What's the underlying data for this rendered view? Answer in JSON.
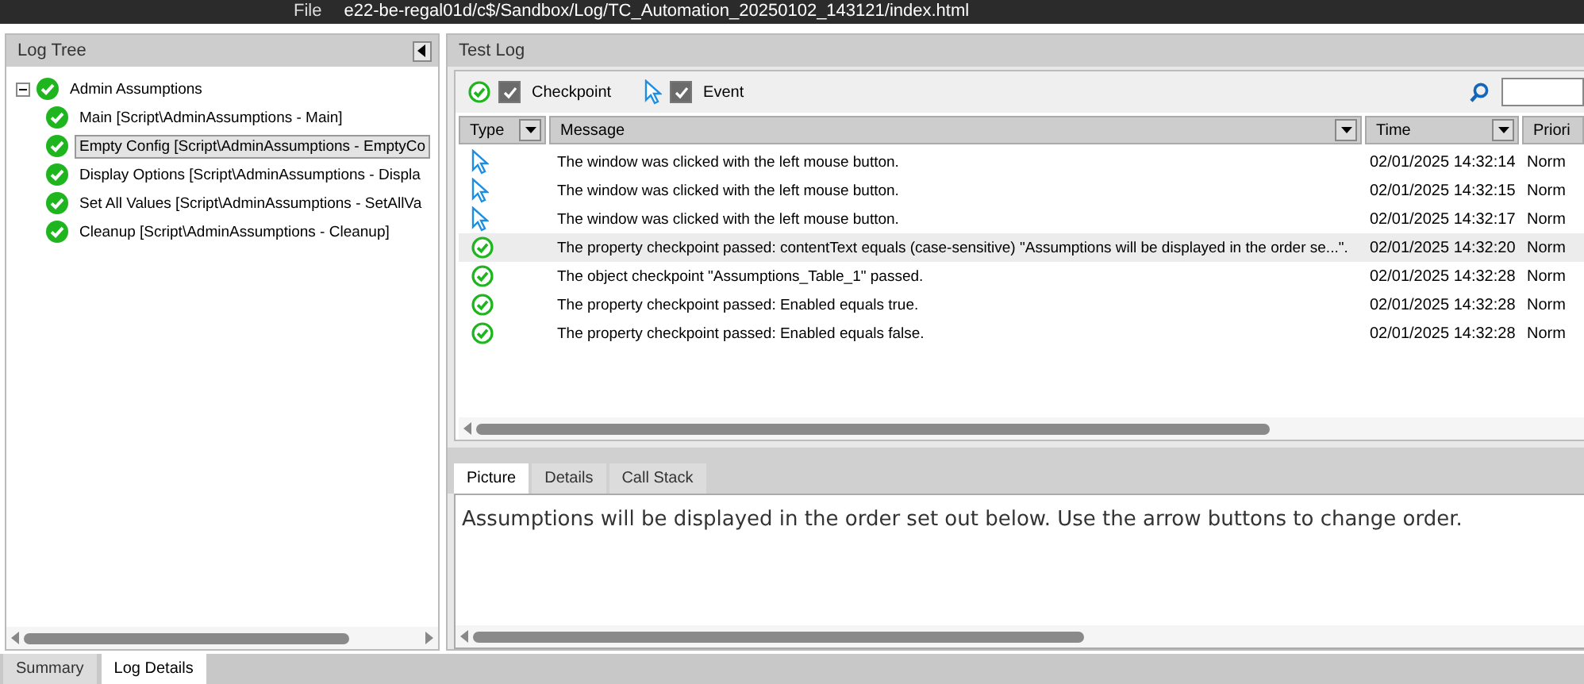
{
  "browser": {
    "scheme": "File",
    "url": "e22-be-regal01d/c$/Sandbox/Log/TC_Automation_20250102_143121/index.html"
  },
  "log_tree": {
    "title": "Log Tree",
    "items": [
      {
        "label": "Admin Assumptions",
        "expanded": true,
        "selected": false,
        "children": [
          {
            "label": "Main [Script\\AdminAssumptions - Main]",
            "selected": false
          },
          {
            "label": "Empty Config [Script\\AdminAssumptions - EmptyCo",
            "selected": true
          },
          {
            "label": "Display Options [Script\\AdminAssumptions - Displa",
            "selected": false
          },
          {
            "label": "Set All Values [Script\\AdminAssumptions - SetAllVa",
            "selected": false
          },
          {
            "label": "Cleanup [Script\\AdminAssumptions - Cleanup]",
            "selected": false
          }
        ]
      }
    ]
  },
  "test_log": {
    "title": "Test Log",
    "filters": [
      {
        "kind": "checkpoint",
        "label": "Checkpoint",
        "checked": true
      },
      {
        "kind": "event",
        "label": "Event",
        "checked": true
      }
    ],
    "columns": [
      "Type",
      "Message",
      "Time",
      "Priori"
    ],
    "rows": [
      {
        "kind": "event",
        "message": "The window was clicked with the left mouse button.",
        "time": "02/01/2025 14:32:14",
        "priority": "Norm",
        "selected": false
      },
      {
        "kind": "event",
        "message": "The window was clicked with the left mouse button.",
        "time": "02/01/2025 14:32:15",
        "priority": "Norm",
        "selected": false
      },
      {
        "kind": "event",
        "message": "The window was clicked with the left mouse button.",
        "time": "02/01/2025 14:32:17",
        "priority": "Norm",
        "selected": false
      },
      {
        "kind": "checkpoint",
        "message": "The property checkpoint passed: contentText equals (case-sensitive) \"Assumptions will be displayed in the order se...\".",
        "time": "02/01/2025 14:32:20",
        "priority": "Norm",
        "selected": true
      },
      {
        "kind": "checkpoint",
        "message": "The object checkpoint \"Assumptions_Table_1\" passed.",
        "time": "02/01/2025 14:32:28",
        "priority": "Norm",
        "selected": false
      },
      {
        "kind": "checkpoint",
        "message": "The property checkpoint passed: Enabled equals true.",
        "time": "02/01/2025 14:32:28",
        "priority": "Norm",
        "selected": false
      },
      {
        "kind": "checkpoint",
        "message": "The property checkpoint passed: Enabled equals false.",
        "time": "02/01/2025 14:32:28",
        "priority": "Norm",
        "selected": false
      }
    ]
  },
  "detail_tabs": [
    {
      "label": "Picture",
      "selected": true
    },
    {
      "label": "Details",
      "selected": false
    },
    {
      "label": "Call Stack",
      "selected": false
    }
  ],
  "picture_text": "Assumptions will be displayed in the order set out below. Use the arrow buttons to change order.",
  "bottom_tabs": [
    {
      "label": "Summary",
      "selected": false
    },
    {
      "label": "Log Details",
      "selected": true
    }
  ]
}
